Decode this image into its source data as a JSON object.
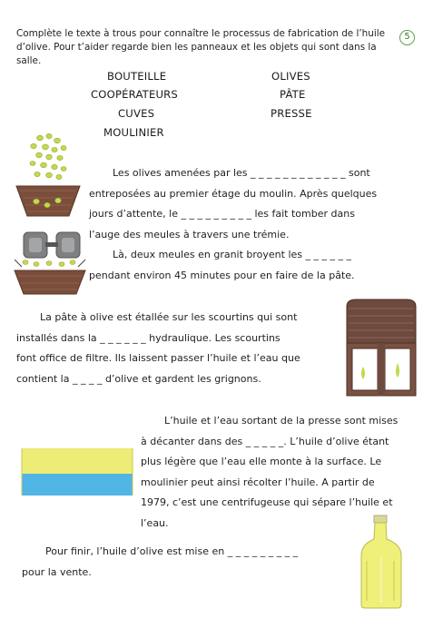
{
  "instructions": {
    "line1": "Complète le texte à trous pour connaître le processus de fabrication de l’huile",
    "line2": "d’olive. Pour t’aider regarde bien les panneaux et les objets qui sont dans la salle."
  },
  "page_number": "5",
  "word_bank": [
    "BOUTEILLE",
    "COOPÉRATEURS",
    "CUVES",
    "MOULINIER",
    "OLIVES",
    "PÂTE",
    "PRESSE"
  ],
  "paragraphs": {
    "p1": {
      "l1": "Les olives amenées par les _ _ _ _ _ _ _ _ _ _ _ _ sont",
      "l2": "entreposées au premier étage du moulin. Après quelques",
      "l3": "jours d’attente, le _ _ _ _ _ _ _ _ _ les fait tomber dans",
      "l4": "l’auge des meules à travers une trémie.",
      "l5": "Là, deux meules en granit broyent les _ _ _ _ _ _",
      "l6": "pendant environ 45 minutes pour en faire de la pâte."
    },
    "p2": {
      "l1": "La pâte à olive est étallée sur les scourtins qui sont",
      "l2": "installés dans la _ _ _ _ _ _ hydraulique. Les scourtins",
      "l3": "font office de filtre. Ils laissent passer l’huile et l’eau que",
      "l4": "contient la _ _ _ _ d’olive et gardent les grignons."
    },
    "p3": {
      "l1": "L’huile et l’eau sortant de la presse sont mises",
      "l2": "à décanter dans des _ _ _ _ _. L’huile d’olive étant",
      "l3": "plus légère que l’eau elle monte à la surface. Le",
      "l4": "moulinier peut ainsi récolter l’huile. A partir de",
      "l5": "1979, c’est une centrifugeuse qui sépare l’huile et",
      "l6": "l’eau."
    },
    "p4": {
      "l1": "Pour finir, l’huile d’olive est mise en _ _ _ _ _ _ _ _ _",
      "l2": "pour la vente."
    }
  },
  "colors": {
    "olive_green": "#c4d94a",
    "basket_brown": "#7a4e3a",
    "millstone_gray": "#7f8082",
    "press_brown": "#6e4a3e",
    "oil_yellow": "#e6e64a",
    "water_blue": "#33a8e0",
    "badge_green": "#5aa34a"
  }
}
